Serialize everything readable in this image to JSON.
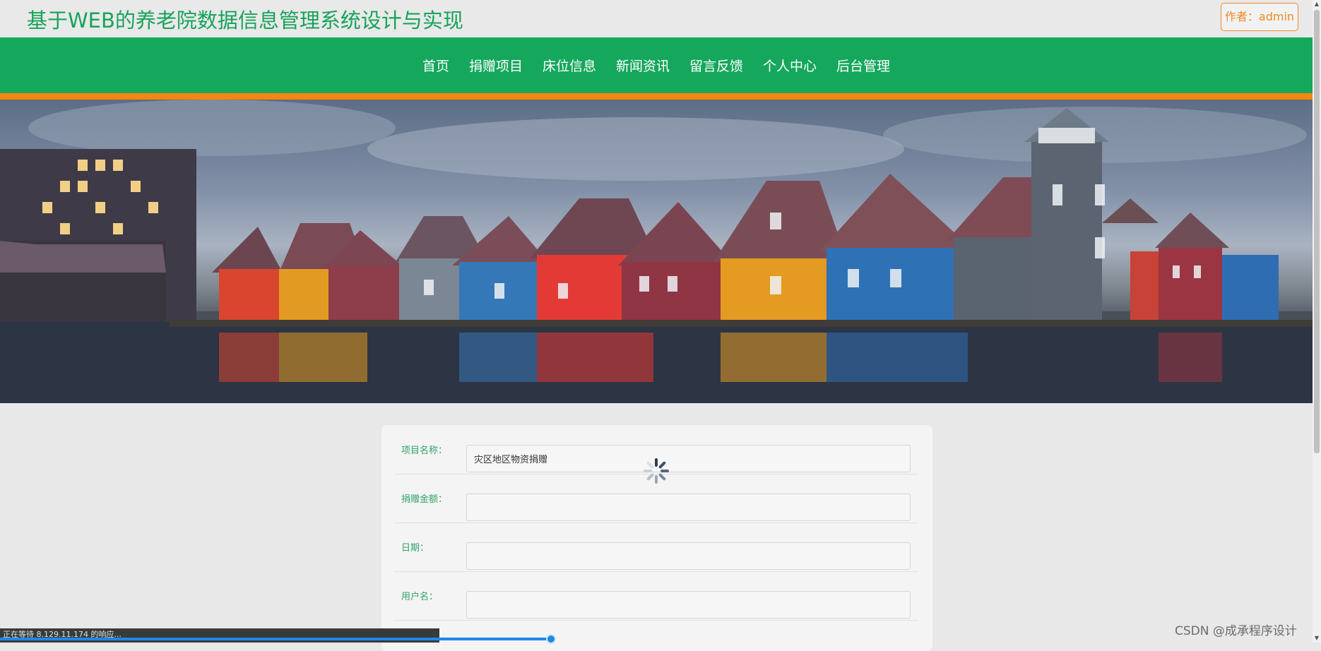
{
  "header": {
    "title": "基于WEB的养老院数据信息管理系统设计与实现",
    "author_button": "作者：admin"
  },
  "nav": {
    "items": [
      "首页",
      "捐赠项目",
      "床位信息",
      "新闻资讯",
      "留言反馈",
      "个人中心",
      "后台管理"
    ]
  },
  "banner": {
    "slide_count": 3,
    "active_slide": 1
  },
  "form": {
    "fields": [
      {
        "label": "项目名称：",
        "value": "灾区地区物资捐赠"
      },
      {
        "label": "捐赠金额：",
        "value": ""
      },
      {
        "label": "日期：",
        "value": ""
      },
      {
        "label": "用户名：",
        "value": ""
      }
    ]
  },
  "status": {
    "text": "正在等待 8.129.11.174 的响应...",
    "progress": 0.42
  },
  "watermark": "CSDN @成承程序设计",
  "colors": {
    "brand_green": "#15a75c",
    "accent_orange": "#f7860f",
    "label_green": "#2fa367"
  }
}
